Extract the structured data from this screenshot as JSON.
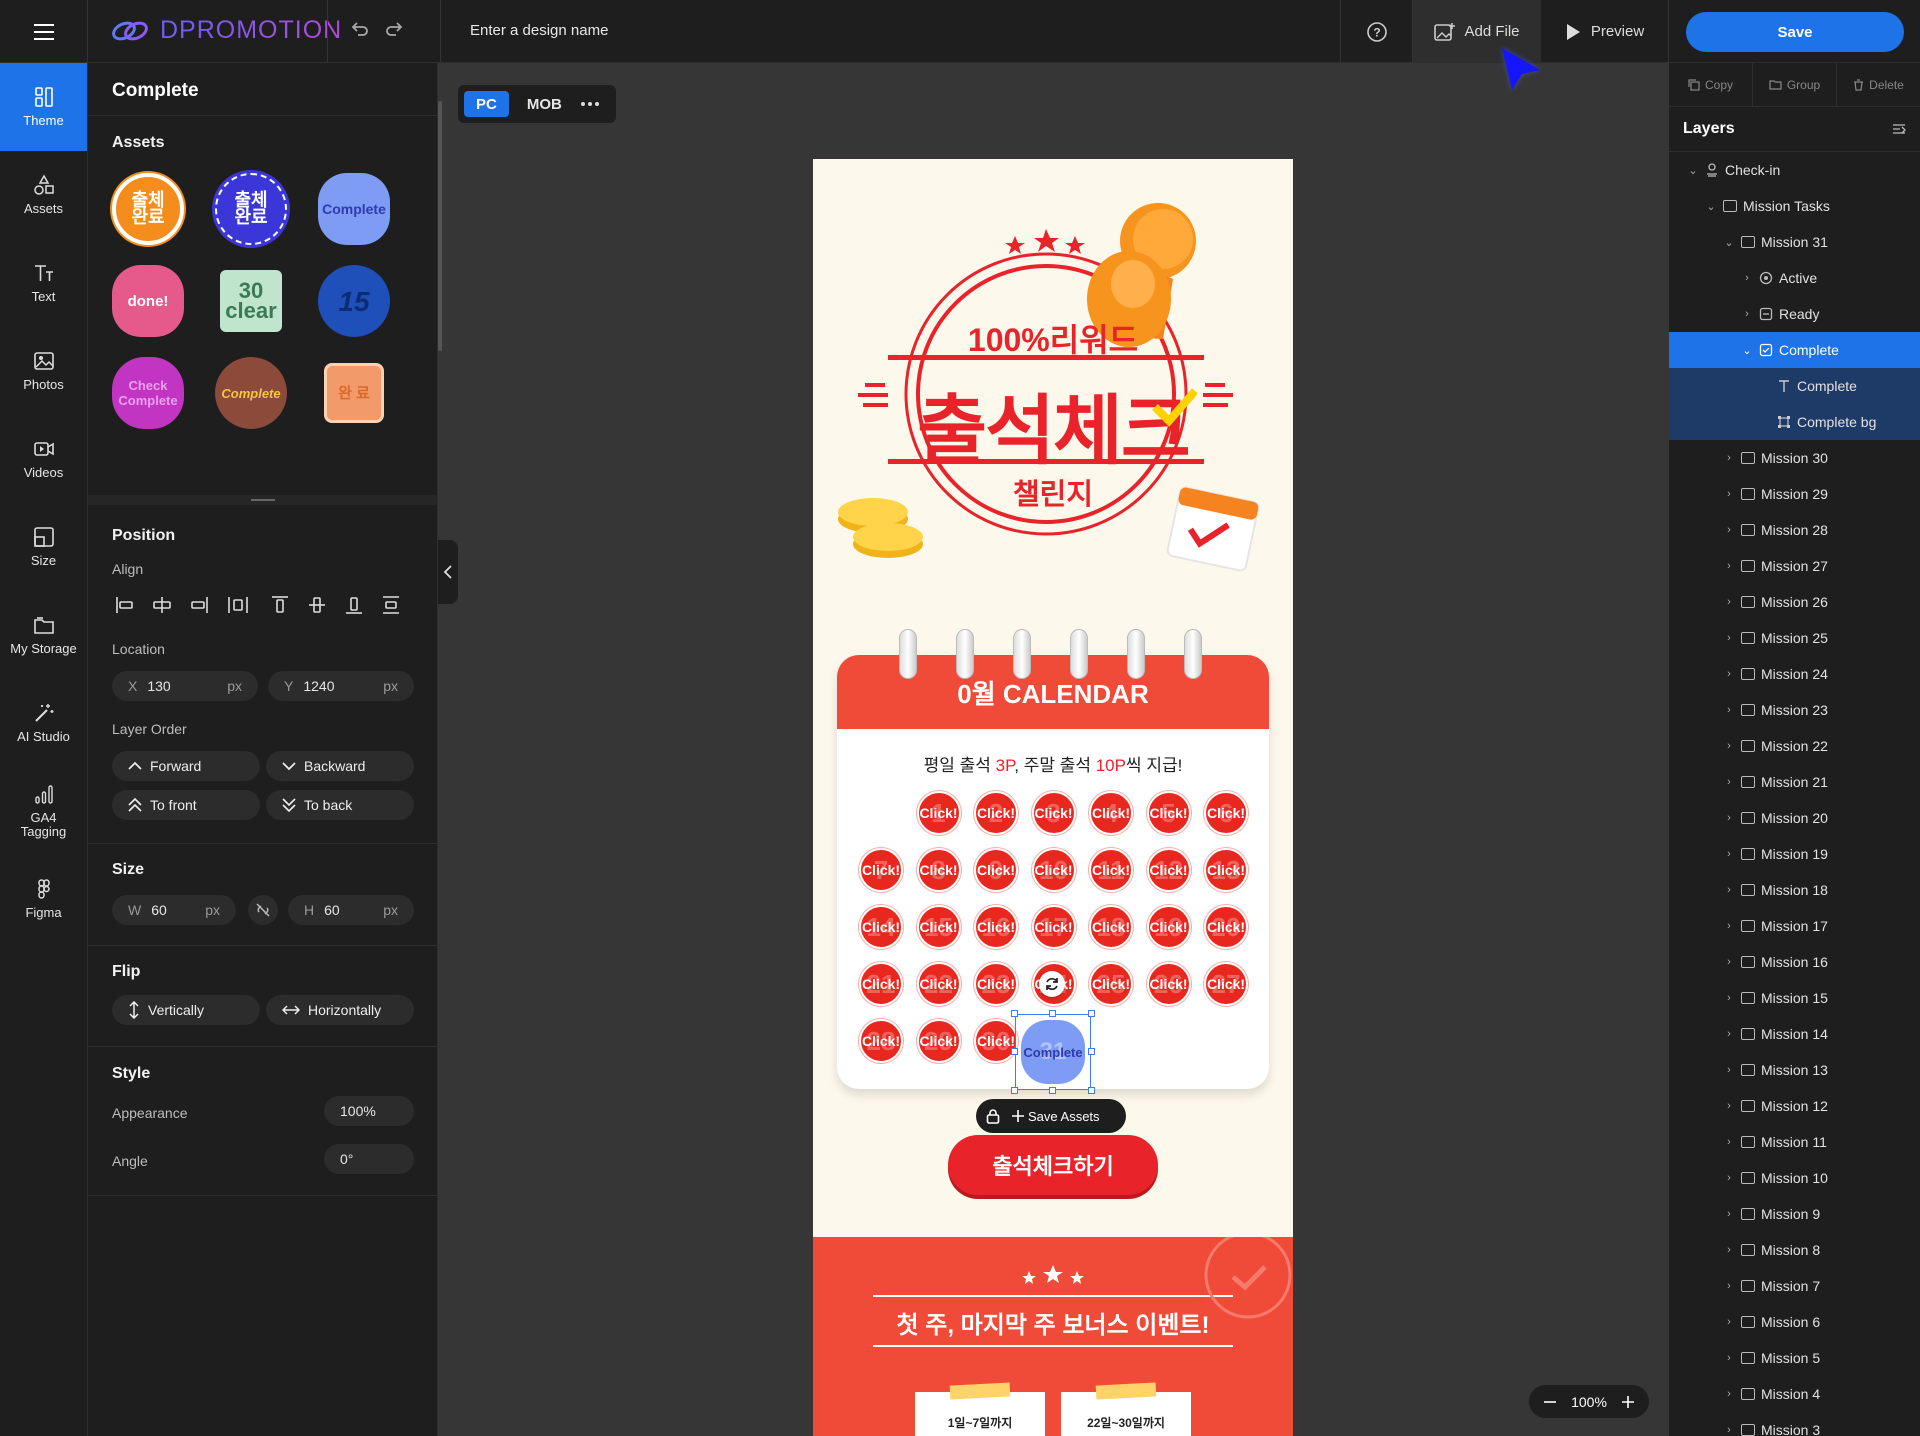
{
  "topbar": {
    "brand": "DPROMOTION",
    "design_name_placeholder": "Enter a design name",
    "add_file": "Add File",
    "preview": "Preview",
    "save": "Save"
  },
  "rail": [
    {
      "label": "Theme",
      "icon": "theme-icon",
      "active": true
    },
    {
      "label": "Assets",
      "icon": "assets-icon"
    },
    {
      "label": "Text",
      "icon": "text-icon"
    },
    {
      "label": "Photos",
      "icon": "photos-icon"
    },
    {
      "label": "Videos",
      "icon": "videos-icon"
    },
    {
      "label": "Size",
      "icon": "size-icon"
    },
    {
      "label": "My Storage",
      "icon": "folder-icon"
    },
    {
      "label": "AI Studio",
      "icon": "magic-wand-icon"
    },
    {
      "label": "GA4 Tagging",
      "icon": "bar-chart-icon"
    },
    {
      "label": "Figma",
      "icon": "figma-icon"
    }
  ],
  "panel": {
    "title": "Complete",
    "assets_title": "Assets",
    "assets": [
      "출체\n완료",
      "출체\n완료",
      "Complete",
      "done!",
      "30\nclear",
      "15",
      "Check\nComplete",
      "Complete",
      "완 료"
    ],
    "position_title": "Position",
    "align_label": "Align",
    "location_label": "Location",
    "x_key": "X",
    "x_value": "130",
    "y_key": "Y",
    "y_value": "1240",
    "unit": "px",
    "layer_order_label": "Layer Order",
    "forward": "Forward",
    "backward": "Backward",
    "to_front": "To front",
    "to_back": "To back",
    "size_title": "Size",
    "w_key": "W",
    "w_value": "60",
    "h_key": "H",
    "h_value": "60",
    "flip_title": "Flip",
    "vertically": "Vertically",
    "horizontally": "Horizontally",
    "style_title": "Style",
    "appearance_label": "Appearance",
    "appearance_value": "100%",
    "angle_label": "Angle",
    "angle_value": "0°"
  },
  "canvas": {
    "tab_pc": "PC",
    "tab_mob": "MOB",
    "reward": "100%리워드",
    "headline": "출석체크",
    "challenge": "챌린지",
    "calendar_title": "0월 CALENDAR",
    "notice_a": "평일 출석 ",
    "notice_b": "3P",
    "notice_c": ", 주말 출석 ",
    "notice_d": "10P",
    "notice_e": "씩 지급!",
    "click_label": "Click!",
    "selected_day_label": "Complete",
    "selected_day_number": "31",
    "save_assets": "Save Assets",
    "cta": "출석체크하기",
    "bonus_title": "첫 주, 마지막 주 보너스 이벤트!",
    "card1": "1일~7일까지",
    "card2": "22일~30일까지",
    "zoom": "100%"
  },
  "layers": {
    "copy": "Copy",
    "group": "Group",
    "delete": "Delete",
    "title": "Layers",
    "root": "Check-in",
    "tasks": "Mission Tasks",
    "m31": "Mission 31",
    "active": "Active",
    "ready": "Ready",
    "complete": "Complete",
    "complete_text": "Complete",
    "complete_bg": "Complete bg",
    "missions": [
      "Mission 30",
      "Mission 29",
      "Mission 28",
      "Mission 27",
      "Mission 26",
      "Mission 25",
      "Mission 24",
      "Mission 23",
      "Mission 22",
      "Mission 21",
      "Mission 20",
      "Mission 19",
      "Mission 18",
      "Mission 17",
      "Mission 16",
      "Mission 15",
      "Mission 14",
      "Mission 13",
      "Mission 12",
      "Mission 11",
      "Mission 10",
      "Mission 9",
      "Mission 8",
      "Mission 7",
      "Mission 6",
      "Mission 5",
      "Mission 4",
      "Mission 3"
    ]
  },
  "colors": {
    "accent": "#1f73e8",
    "brand_red": "#f04a38",
    "dark": "#1e1e1e"
  }
}
